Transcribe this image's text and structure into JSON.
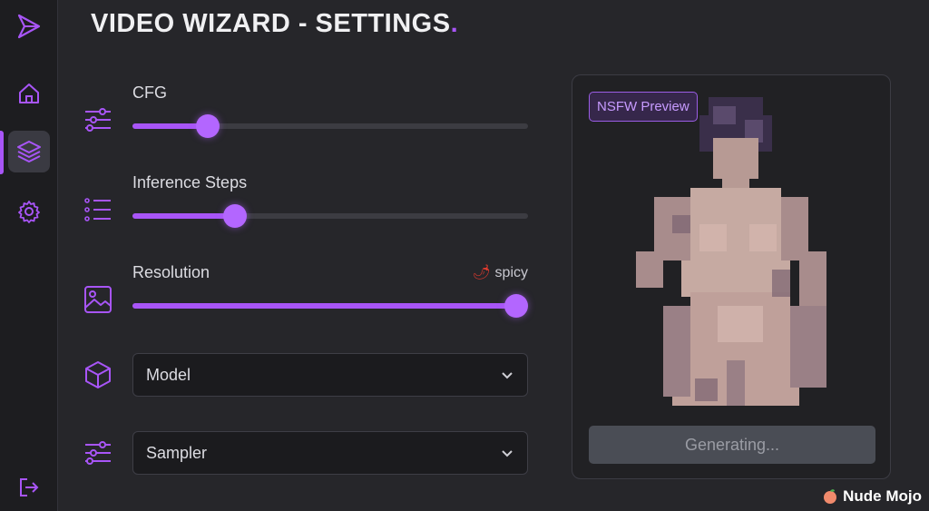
{
  "app": {
    "title": "VIDEO WIZARD - SETTINGS",
    "title_dot": ".",
    "accent_color": "#a855f7"
  },
  "sidebar": {
    "items": [
      {
        "icon": "logo-icon"
      },
      {
        "icon": "home-icon"
      },
      {
        "icon": "layers-icon",
        "active": true
      },
      {
        "icon": "gear-icon"
      },
      {
        "icon": "logout-icon"
      }
    ]
  },
  "settings": {
    "cfg": {
      "label": "CFG",
      "value_fraction": 0.19
    },
    "inference_steps": {
      "label": "Inference Steps",
      "value_fraction": 0.26
    },
    "resolution": {
      "label": "Resolution",
      "badge": "spicy",
      "badge_icon": "chili-pepper-icon",
      "value_fraction": 0.97
    },
    "model": {
      "label": "Model"
    },
    "sampler": {
      "label": "Sampler"
    }
  },
  "preview": {
    "badge": "NSFW Preview",
    "generate_label": "Generating..."
  },
  "watermark": {
    "text": "Nude Mojo",
    "icon": "peach-icon"
  }
}
